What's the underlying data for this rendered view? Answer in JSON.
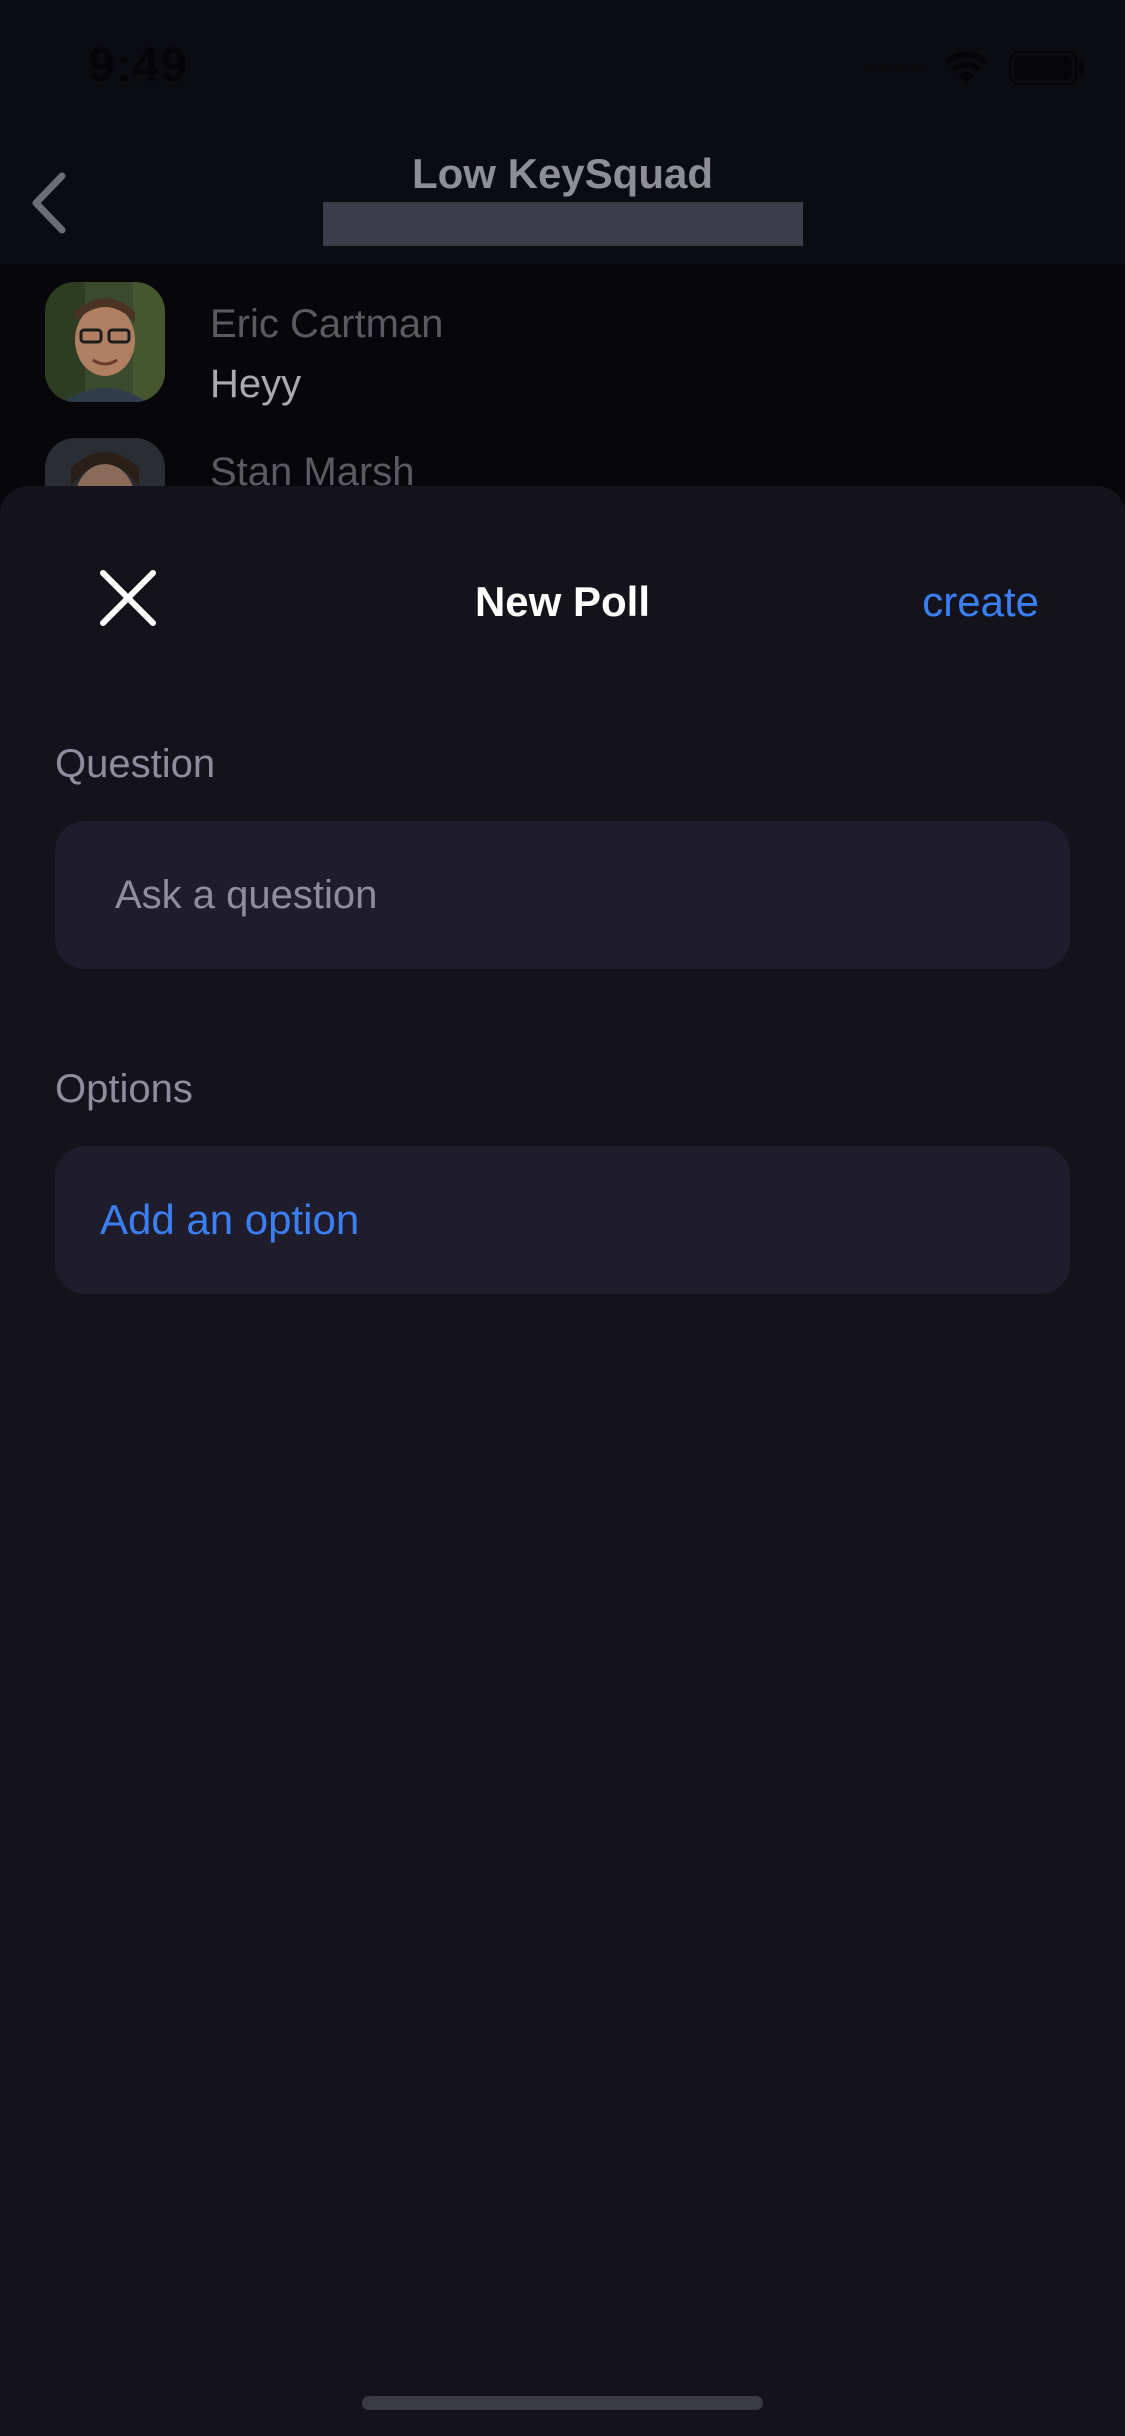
{
  "status_bar": {
    "time": "9:49",
    "icons": [
      "signal-dots-icon",
      "wifi-icon",
      "battery-icon"
    ]
  },
  "chat": {
    "title": "Low KeySquad",
    "messages": [
      {
        "sender": "Eric Cartman",
        "text": "Heyy"
      },
      {
        "sender": "Stan Marsh",
        "text": ""
      }
    ]
  },
  "poll_sheet": {
    "title": "New Poll",
    "create_label": "create",
    "question_label": "Question",
    "question_placeholder": "Ask a question",
    "question_value": "",
    "options_label": "Options",
    "add_option_label": "Add an option"
  },
  "colors": {
    "accent": "#3b7ff5",
    "sheet_background": "#14131c",
    "field_background": "#1f1d2c",
    "muted_text": "#8f8d9c"
  }
}
